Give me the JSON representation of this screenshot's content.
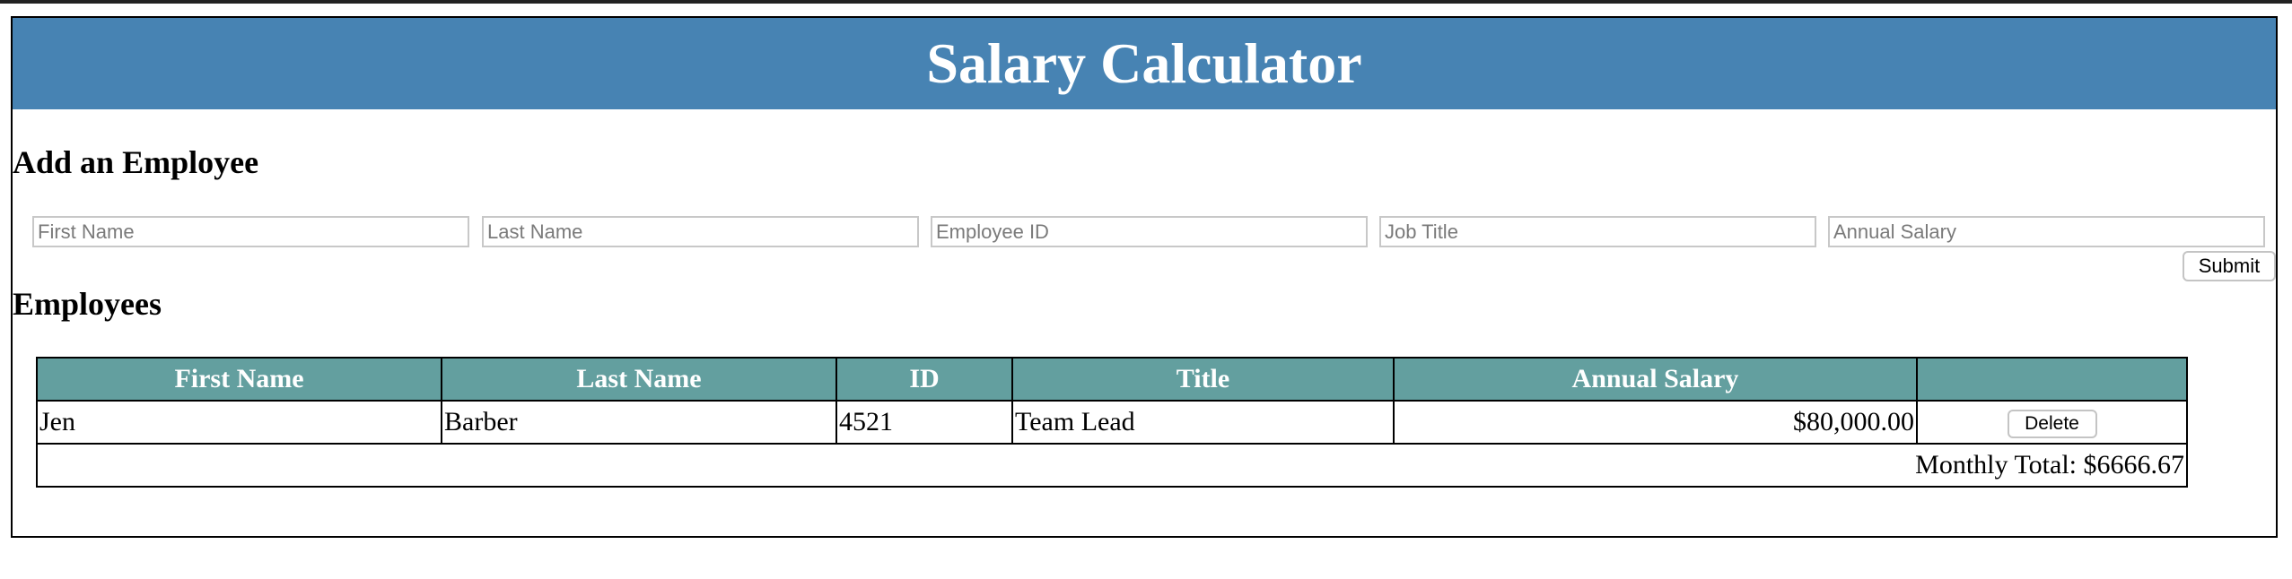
{
  "app": {
    "title": "Salary Calculator"
  },
  "add_section": {
    "title": "Add an Employee",
    "fields": [
      {
        "placeholder": "First Name",
        "value": ""
      },
      {
        "placeholder": "Last Name",
        "value": ""
      },
      {
        "placeholder": "Employee ID",
        "value": ""
      },
      {
        "placeholder": "Job Title",
        "value": ""
      },
      {
        "placeholder": "Annual Salary",
        "value": ""
      }
    ],
    "submit_label": "Submit"
  },
  "employees_section": {
    "title": "Employees",
    "columns": [
      "First Name",
      "Last Name",
      "ID",
      "Title",
      "Annual Salary",
      ""
    ],
    "rows": [
      {
        "first_name": "Jen",
        "last_name": "Barber",
        "id": "4521",
        "title": "Team Lead",
        "annual_salary": "$80,000.00",
        "delete_label": "Delete"
      }
    ],
    "monthly_total": "Monthly Total: $6666.67"
  },
  "colors": {
    "header_bg": "#4783b3",
    "table_header_bg": "#639f9f"
  }
}
